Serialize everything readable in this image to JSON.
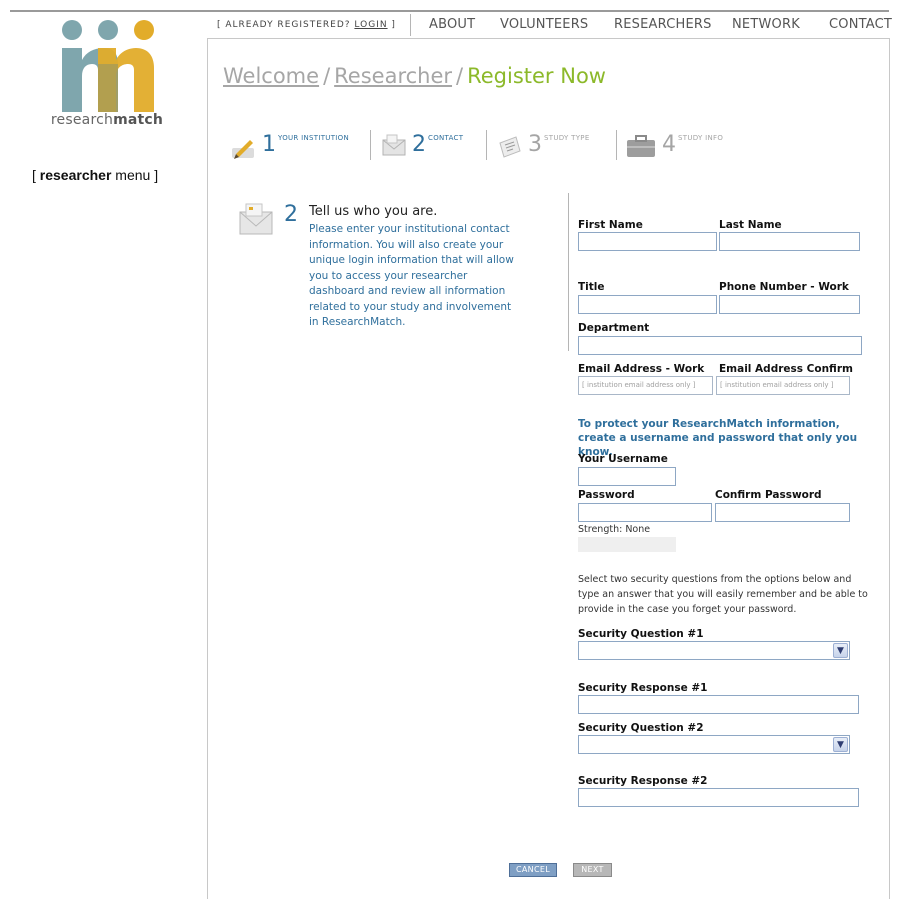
{
  "brand": {
    "logo_mark": "rm",
    "name_light": "research",
    "name_bold": "match",
    "colors": {
      "teal": "#7fa6ad",
      "gold": "#e2ac2a",
      "link_blue": "#2f6f9c",
      "green": "#8cb92a"
    }
  },
  "sidebar": {
    "menu_open": "[ ",
    "menu_bold": "researcher",
    "menu_rest": " menu ]"
  },
  "topnav": {
    "already_prefix": "[ ALREADY REGISTERED? ",
    "login": "LOGIN",
    "already_suffix": " ]",
    "links": [
      "ABOUT",
      "VOLUNTEERS",
      "RESEARCHERS",
      "NETWORK",
      "CONTACT"
    ]
  },
  "breadcrumb": {
    "welcome": "Welcome",
    "sep": "/",
    "researcher": "Researcher",
    "current": "Register Now"
  },
  "steps": [
    {
      "num": "1",
      "label": "YOUR INSTITUTION",
      "icon": "pencil-icon",
      "active": true
    },
    {
      "num": "2",
      "label": "CONTACT",
      "icon": "envelope-icon",
      "active": true
    },
    {
      "num": "3",
      "label": "STUDY TYPE",
      "icon": "document-icon",
      "active": false
    },
    {
      "num": "4",
      "label": "STUDY INFO",
      "icon": "briefcase-icon",
      "active": false
    }
  ],
  "intro": {
    "num": "2",
    "heading": "Tell us who you are.",
    "body": "Please enter your institutional contact information. You will also create your unique login information that will allow you to access your researcher dashboard and review all information related to your study and involvement in ResearchMatch."
  },
  "form": {
    "first_name": "First Name",
    "last_name": "Last Name",
    "title": "Title",
    "phone": "Phone Number - Work",
    "department": "Department",
    "email": "Email Address - Work",
    "email_confirm": "Email Address Confirm",
    "email_placeholder": "[ institution email address only ]",
    "protect_note": "To protect your ResearchMatch information, create a username and password that only you know.",
    "username": "Your Username",
    "password": "Password",
    "confirm_password": "Confirm Password",
    "strength": "Strength: None",
    "security_note": "Select two security questions from the options below and type an answer that you will easily remember and be able to provide in the case you forget your password.",
    "sq1": "Security Question #1",
    "sr1": "Security Response #1",
    "sq2": "Security Question #2",
    "sr2": "Security Response #2"
  },
  "buttons": {
    "cancel": "CANCEL",
    "next": "NEXT"
  }
}
